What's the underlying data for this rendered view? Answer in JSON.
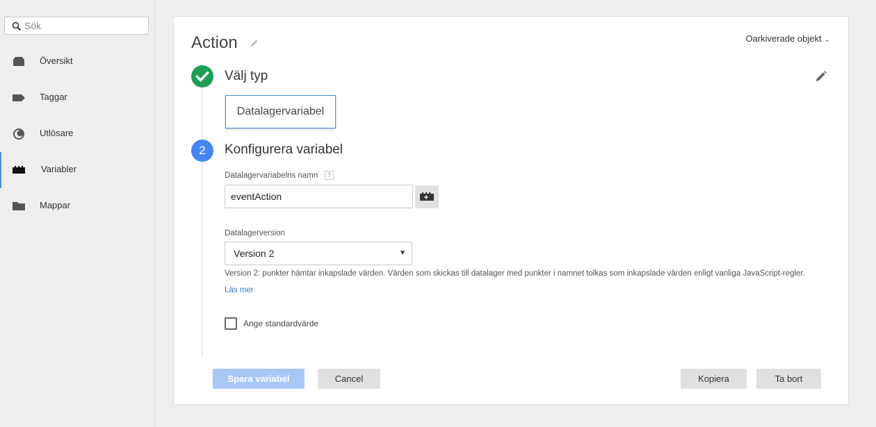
{
  "search": {
    "placeholder": "Sök"
  },
  "sidebar": {
    "items": [
      {
        "label": "Översikt",
        "icon": "overview-icon"
      },
      {
        "label": "Taggar",
        "icon": "tag-icon"
      },
      {
        "label": "Utlösare",
        "icon": "trigger-icon"
      },
      {
        "label": "Variabler",
        "icon": "variables-icon",
        "active": true
      },
      {
        "label": "Mappar",
        "icon": "folder-icon"
      }
    ]
  },
  "card": {
    "title": "Action",
    "unarchived_label": "Oarkiverade objekt",
    "step1": {
      "title": "Välj typ",
      "type_value": "Datalagervariabel"
    },
    "step2": {
      "number": "2",
      "title": "Konfigurera variabel",
      "name_label": "Datalagervariabelns namn",
      "help": "?",
      "name_value": "eventAction",
      "version_label": "Datalagerversion",
      "version_value": "Version 2",
      "description": "Version 2: punkter hämtar inkapslade värden. Värden som skickas till datalager med punkter i namnet tolkas som inkapslade värden enligt vanliga JavaScript-regler.",
      "read_more": "Läs mer",
      "default_checkbox_label": "Ange standardvärde",
      "default_checked": false
    }
  },
  "buttons": {
    "save": "Spara variabel",
    "cancel": "Cancel",
    "copy": "Kopiera",
    "delete": "Ta bort"
  },
  "colors": {
    "check_green": "#1e9e54",
    "step_blue": "#4285f4",
    "save_disabled": "#a8c8f8",
    "link": "#3a78d1"
  }
}
